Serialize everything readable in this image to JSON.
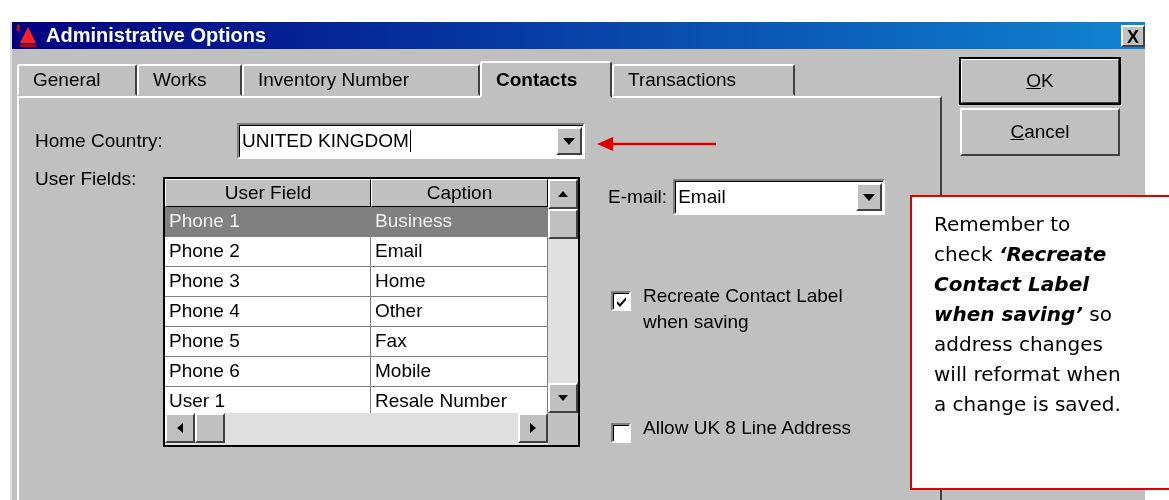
{
  "window": {
    "title": "Administrative Options",
    "close": "X"
  },
  "tabs": [
    {
      "label": "General",
      "selected": false
    },
    {
      "label": "Works",
      "selected": false
    },
    {
      "label": "Inventory Number",
      "selected": false
    },
    {
      "label": "Contacts",
      "selected": true
    },
    {
      "label": "Transactions",
      "selected": false
    }
  ],
  "home_country": {
    "label": "Home Country:",
    "value": "UNITED KINGDOM"
  },
  "user_fields": {
    "label": "User Fields:",
    "columns": [
      "User Field",
      "Caption"
    ],
    "rows": [
      {
        "cells": [
          "Phone 1",
          "Business"
        ],
        "selected": true
      },
      {
        "cells": [
          "Phone 2",
          "Email"
        ],
        "selected": false
      },
      {
        "cells": [
          "Phone 3",
          "Home"
        ],
        "selected": false
      },
      {
        "cells": [
          "Phone 4",
          "Other"
        ],
        "selected": false
      },
      {
        "cells": [
          "Phone 5",
          "Fax"
        ],
        "selected": false
      },
      {
        "cells": [
          "Phone 6",
          "Mobile"
        ],
        "selected": false
      },
      {
        "cells": [
          "User 1",
          "Resale Number"
        ],
        "selected": false
      }
    ]
  },
  "email": {
    "label": "E-mail:",
    "value": "Email"
  },
  "options": [
    {
      "label": "Recreate Contact Label when saving",
      "checked": true
    },
    {
      "label": "Allow UK 8 Line Address",
      "checked": false
    }
  ],
  "buttons": [
    "OK",
    "Cancel"
  ],
  "callout": {
    "text": "Remember to check **‘Recreate Contact Label when saving’** so address changes will reformat when a change is saved."
  }
}
